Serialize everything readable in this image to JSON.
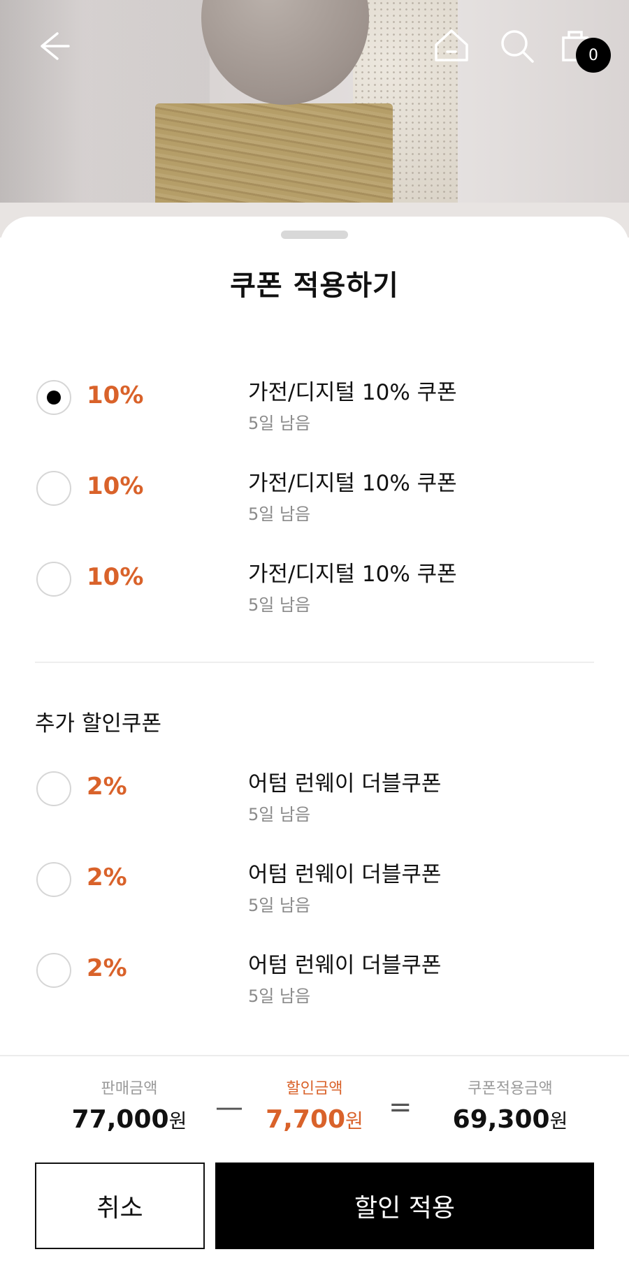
{
  "header": {
    "cart_count": "0"
  },
  "sheet": {
    "title": "쿠폰 적용하기",
    "coupons": [
      {
        "rate": "10%",
        "name": "가전/디지털 10% 쿠폰",
        "days": "5일 남음",
        "selected": true
      },
      {
        "rate": "10%",
        "name": "가전/디지털 10% 쿠폰",
        "days": "5일 남음",
        "selected": false
      },
      {
        "rate": "10%",
        "name": "가전/디지털 10% 쿠폰",
        "days": "5일 남음",
        "selected": false
      }
    ],
    "extra_section_title": "추가 할인쿠폰",
    "extra_coupons": [
      {
        "rate": "2%",
        "name": "어텀 런웨이 더블쿠폰",
        "days": "5일 남음",
        "selected": false
      },
      {
        "rate": "2%",
        "name": "어텀 런웨이 더블쿠폰",
        "days": "5일 남음",
        "selected": false
      },
      {
        "rate": "2%",
        "name": "어텀 런웨이 더블쿠폰",
        "days": "5일 남음",
        "selected": false
      }
    ]
  },
  "summary": {
    "sale_label": "판매금액",
    "sale_value": "77,000",
    "discount_label": "할인금액",
    "discount_value": "7,700",
    "final_label": "쿠폰적용금액",
    "final_value": "69,300",
    "currency": "원",
    "minus_op": "—",
    "equals_op": "="
  },
  "buttons": {
    "cancel": "취소",
    "apply": "할인 적용"
  },
  "colors": {
    "accent": "#d9622a",
    "primary": "#000000"
  }
}
